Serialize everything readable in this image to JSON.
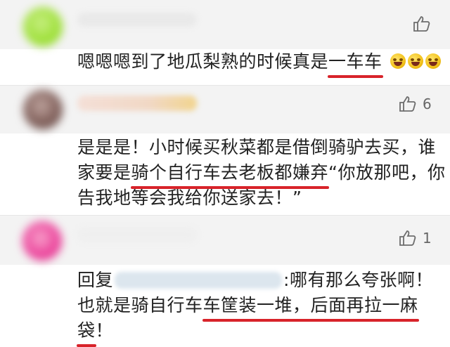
{
  "comments": [
    {
      "like_count": "",
      "text_before": "嗯嗯嗯到了地瓜梨熟的时候真是",
      "text_highlight": "一车车",
      "emojis": [
        "grinning-tears-emoji",
        "grinning-tears-emoji",
        "grinning-tears-emoji"
      ]
    },
    {
      "like_count": "6",
      "line1": "是是是！小时候买秋菜都是借倒骑驴去买，谁",
      "line2_before": "家要是",
      "line2_highlight": "骑个自行车去老板都嫌弃",
      "line2_after": "“你放那吧，你",
      "line3": "告我地等会我给你送家去！”"
    },
    {
      "like_count": "1",
      "reply_prefix": "回复",
      "reply_after": ":哪有那么夸张啊！",
      "line2_before": "也就是骑自行车",
      "line2_highlight": "车筐装一堆，后面再拉一麻",
      "line3_highlight": "袋",
      "line3_after": "！"
    }
  ],
  "icons": {
    "like": "thumbs-up-icon"
  }
}
